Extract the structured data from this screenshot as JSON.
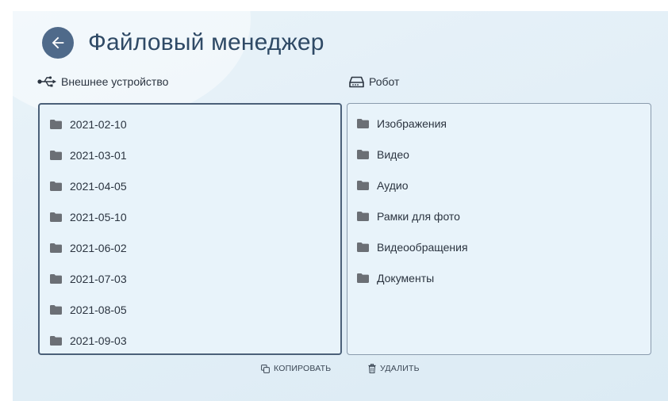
{
  "header": {
    "title": "Файловый менеджер",
    "back_icon": "arrow-left-icon"
  },
  "left_panel": {
    "label": "Внешнее устройство",
    "icon": "usb-icon",
    "items": [
      "2021-02-10",
      "2021-03-01",
      "2021-04-05",
      "2021-05-10",
      "2021-06-02",
      "2021-07-03",
      "2021-08-05",
      "2021-09-03"
    ]
  },
  "right_panel": {
    "label": "Робот",
    "icon": "hard-drive-icon",
    "items": [
      "Изображения",
      "Видео",
      "Аудио",
      "Рамки для фото",
      "Видеообращения",
      "Документы"
    ]
  },
  "actions": {
    "copy_label": "КОПИРОВАТЬ",
    "delete_label": "УДАЛИТЬ"
  },
  "colors": {
    "accent": "#4f6a8a",
    "folder": "#6b6f75",
    "panel_bg": "#e8f3fa"
  }
}
